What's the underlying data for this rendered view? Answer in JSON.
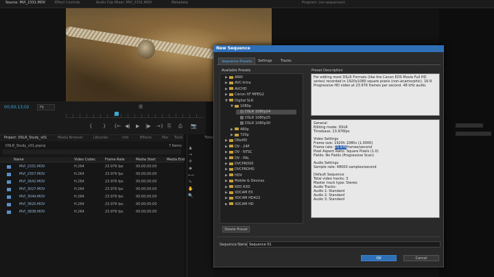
{
  "top_tabs": [
    {
      "label": "Source: MVI_2331.MOV",
      "active": true
    },
    {
      "label": "Effect Controls",
      "active": false
    },
    {
      "label": "Audio Clip Mixer: MVI_2331.MOV",
      "active": false
    },
    {
      "label": "Metadata",
      "active": false
    },
    {
      "label": "Program: (no sequences)",
      "active": false
    }
  ],
  "source_monitor": {
    "timecode": "00;00;13;02",
    "fit": "Fit",
    "controls": [
      "{",
      "}",
      "{←",
      "◀|",
      "▶",
      "|▶",
      "→}",
      "⎘",
      "⎙",
      "📷"
    ]
  },
  "project_panel": {
    "tabs": [
      "Project: DSLR_Study_v01",
      "Media Browser",
      "Libraries",
      "Info",
      "Effects",
      "Mar",
      "Tools"
    ],
    "project_name": "DSLR_Study_v01.prproj",
    "items_count": "7 Items",
    "columns": [
      "Name",
      "Video Codec",
      "Frame Rate",
      "Media Start",
      "Media End"
    ],
    "rows": [
      {
        "name": "MVI_2331.MOV",
        "codec": "H.264",
        "rate": "23.976 fps",
        "start": "00;00;00;00"
      },
      {
        "name": "MVI_2357.MOV",
        "codec": "H.264",
        "rate": "23.976 fps",
        "start": "00;00;00;00"
      },
      {
        "name": "MVI_2642.MOV",
        "codec": "H.264",
        "rate": "23.976 fps",
        "start": "00;00;00;00"
      },
      {
        "name": "MVI_3027.MOV",
        "codec": "H.264",
        "rate": "23.976 fps",
        "start": "00;00;00;00"
      },
      {
        "name": "MVI_3044.MOV",
        "codec": "H.264",
        "rate": "23.976 fps",
        "start": "00;00;00;00"
      },
      {
        "name": "MVI_3820.MOV",
        "codec": "H.264",
        "rate": "23.976 fps",
        "start": "00;00;00;00"
      },
      {
        "name": "MVI_3838.MOV",
        "codec": "H.264",
        "rate": "23.976 fps",
        "start": "00;00;00;00"
      }
    ]
  },
  "dialog": {
    "title": "New Sequence",
    "tabs": [
      "Sequence Presets",
      "Settings",
      "Tracks"
    ],
    "available_presets_label": "Available Presets",
    "preset_description_label": "Preset Description",
    "presets": [
      {
        "label": "ARRI",
        "level": 0,
        "kind": "folder",
        "arrow": "▶"
      },
      {
        "label": "AVC-Intra",
        "level": 0,
        "kind": "folder",
        "arrow": "▶"
      },
      {
        "label": "AVCHD",
        "level": 0,
        "kind": "folder",
        "arrow": "▶"
      },
      {
        "label": "Canon XF MPEG2",
        "level": 0,
        "kind": "folder",
        "arrow": "▶"
      },
      {
        "label": "Digital SLR",
        "level": 0,
        "kind": "folder",
        "arrow": "▼"
      },
      {
        "label": "1080p",
        "level": 1,
        "kind": "folder",
        "arrow": "▼"
      },
      {
        "label": "DSLR 1080p24",
        "level": 2,
        "kind": "file",
        "arrow": "",
        "selected": true
      },
      {
        "label": "DSLR 1080p25",
        "level": 2,
        "kind": "file",
        "arrow": ""
      },
      {
        "label": "DSLR 1080p30",
        "level": 2,
        "kind": "file",
        "arrow": ""
      },
      {
        "label": "480p",
        "level": 1,
        "kind": "folder",
        "arrow": "▶"
      },
      {
        "label": "720p",
        "level": 1,
        "kind": "folder",
        "arrow": "▶"
      },
      {
        "label": "DNxHD",
        "level": 0,
        "kind": "folder",
        "arrow": "▶"
      },
      {
        "label": "DV - 24P",
        "level": 0,
        "kind": "folder",
        "arrow": "▶"
      },
      {
        "label": "DV - NTSC",
        "level": 0,
        "kind": "folder",
        "arrow": "▶"
      },
      {
        "label": "DV - PAL",
        "level": 0,
        "kind": "folder",
        "arrow": "▶"
      },
      {
        "label": "DVCPRO50",
        "level": 0,
        "kind": "folder",
        "arrow": "▶"
      },
      {
        "label": "DVCPROHD",
        "level": 0,
        "kind": "folder",
        "arrow": "▶"
      },
      {
        "label": "HDV",
        "level": 0,
        "kind": "folder",
        "arrow": "▶"
      },
      {
        "label": "Mobile & Devices",
        "level": 0,
        "kind": "folder",
        "arrow": "▶"
      },
      {
        "label": "RED R3D",
        "level": 0,
        "kind": "folder",
        "arrow": "▶"
      },
      {
        "label": "XDCAM EX",
        "level": 0,
        "kind": "folder",
        "arrow": "▶"
      },
      {
        "label": "XDCAM HD422",
        "level": 0,
        "kind": "folder",
        "arrow": "▶"
      },
      {
        "label": "XDCAM HD",
        "level": 0,
        "kind": "folder",
        "arrow": "▶"
      }
    ],
    "description": "For editing most DSLR Formats (like the Canon EOS Movie Full HD series) recorded in 1920x1080 square pixels (non-anamorphic). 16:9 Progressive HD video at 23.976 frames per second. 48 kHz audio.",
    "info_lines": [
      "General",
      "Editing mode: DSLR",
      "Timebase: 23.976fps",
      "",
      "Video Settings",
      "Frame size: 1920h 1080v (1.0000)",
      "Frame rate: |23.976|frames/second",
      "Pixel Aspect Ratio: Square Pixels (1.0)",
      "Fields: No Fields (Progressive Scan)",
      "",
      "Audio Settings",
      "Sample rate: 48000 samples/second",
      "",
      "Default Sequence",
      "Total video tracks: 3",
      "Master track type: Stereo",
      "Audio Tracks:",
      "Audio 1: Standard",
      "Audio 2: Standard",
      "Audio 3: Standard"
    ],
    "delete_preset_label": "Delete Preset",
    "sequence_name_label": "Sequence Name:",
    "sequence_name_value": "Sequence 01",
    "ok_label": "OK",
    "cancel_label": "Cancel"
  },
  "colors": {
    "accent": "#2f6fb5",
    "timecode": "#3aa8d8",
    "folder": "#c5a13a"
  },
  "tools": [
    "selection-tool",
    "track-select-tool",
    "ripple-tool",
    "razor-tool",
    "slip-tool",
    "pen-tool",
    "hand-tool",
    "zoom-tool"
  ]
}
